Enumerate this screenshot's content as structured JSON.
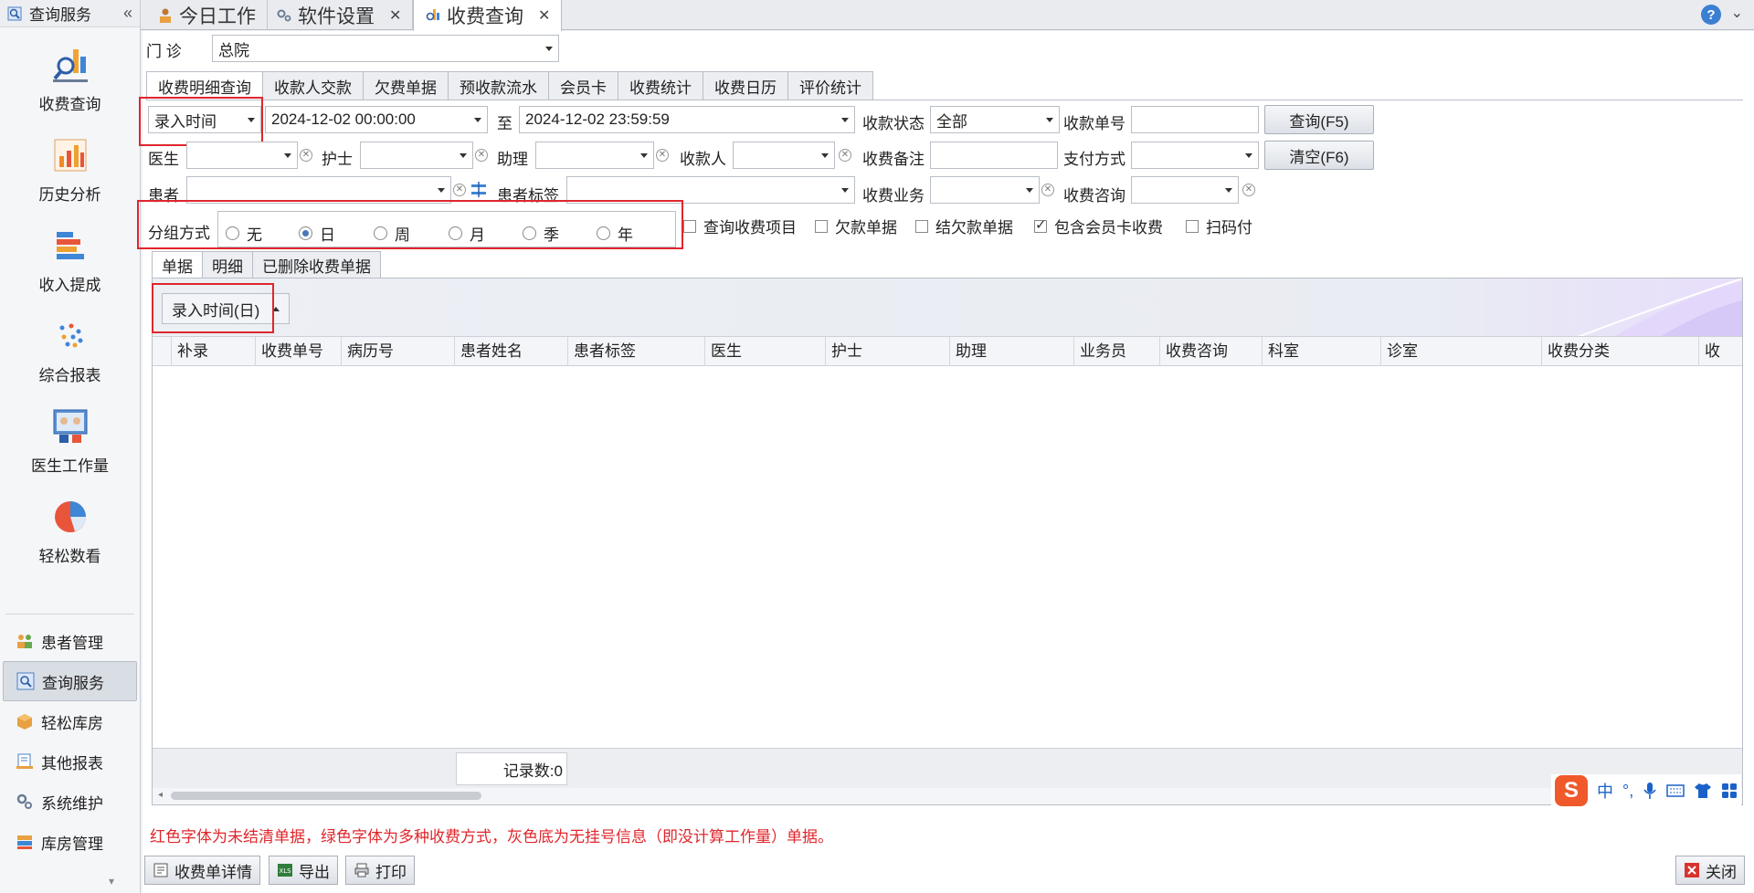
{
  "sidebar": {
    "header_title": "查询服务",
    "collapse_glyph": "«",
    "big_items": [
      {
        "label": "收费查询",
        "icon": "receipt-search-icon"
      },
      {
        "label": "历史分析",
        "icon": "bar-chart-icon"
      },
      {
        "label": "收入提成",
        "icon": "stacked-bars-icon"
      },
      {
        "label": "综合报表",
        "icon": "dots-report-icon"
      },
      {
        "label": "医生工作量",
        "icon": "doctor-workload-icon"
      },
      {
        "label": "轻松数看",
        "icon": "pie-chart-icon"
      }
    ],
    "small_items": [
      {
        "label": "患者管理",
        "icon": "patients-icon"
      },
      {
        "label": "查询服务",
        "icon": "query-service-icon"
      },
      {
        "label": "轻松库房",
        "icon": "warehouse-box-icon"
      },
      {
        "label": "其他报表",
        "icon": "other-report-icon"
      },
      {
        "label": "系统维护",
        "icon": "gears-icon"
      },
      {
        "label": "库房管理",
        "icon": "storage-icon"
      }
    ]
  },
  "window_tabs": [
    {
      "label": "今日工作"
    },
    {
      "label": "软件设置"
    },
    {
      "label": "收费查询"
    }
  ],
  "clinic": {
    "label": "门  诊",
    "value": "总院"
  },
  "sub_tabs": [
    "收费明细查询",
    "收款人交款",
    "欠费单据",
    "预收款流水",
    "会员卡",
    "收费统计",
    "收费日历",
    "评价统计"
  ],
  "filters": {
    "time_type": "录入时间",
    "start": "2024-12-02 00:00:00",
    "to_label": "至",
    "end": "2024-12-02 23:59:59",
    "status_label": "收款状态",
    "status_value": "全部",
    "receipt_no_label": "收款单号",
    "receipt_no_value": "",
    "query_btn": "查询(F5)",
    "doctor_label": "医生",
    "nurse_label": "护士",
    "assistant_label": "助理",
    "cashier_label": "收款人",
    "remark_label": "收费备注",
    "pay_method_label": "支付方式",
    "clear_btn": "清空(F6)",
    "patient_label": "患者",
    "patient_tag_label": "患者标签",
    "business_label": "收费业务",
    "consult_label": "收费咨询"
  },
  "grouping": {
    "label": "分组方式",
    "options": [
      "无",
      "日",
      "周",
      "月",
      "季",
      "年"
    ],
    "selected": "日"
  },
  "checkboxes": [
    {
      "label": "查询收费项目",
      "checked": false
    },
    {
      "label": "欠款单据",
      "checked": false
    },
    {
      "label": "结欠款单据",
      "checked": false
    },
    {
      "label": "包含会员卡收费",
      "checked": true
    },
    {
      "label": "扫码付",
      "checked": false
    }
  ],
  "inner_tabs": [
    "单据",
    "明细",
    "已删除收费单据"
  ],
  "grid": {
    "group_chip": "录入时间(日)",
    "columns": [
      "补录",
      "收费单号",
      "病历号",
      "患者姓名",
      "患者标签",
      "医生",
      "护士",
      "助理",
      "业务员",
      "收费咨询",
      "科室",
      "诊室",
      "收费分类",
      "收"
    ],
    "record_count": "记录数:0"
  },
  "note": "红色字体为未结清单据，绿色字体为多种收费方式，灰色底为无挂号信息（即没计算工作量）单据。",
  "bottom_buttons": {
    "detail": "收费单详情",
    "export": "导出",
    "print": "打印",
    "close": "关闭"
  },
  "ime": {
    "logo": "S",
    "mode": "中"
  },
  "colors": {
    "accent_red": "#e0262c",
    "ime_orange": "#f0592a",
    "link_blue": "#1a62c8"
  }
}
